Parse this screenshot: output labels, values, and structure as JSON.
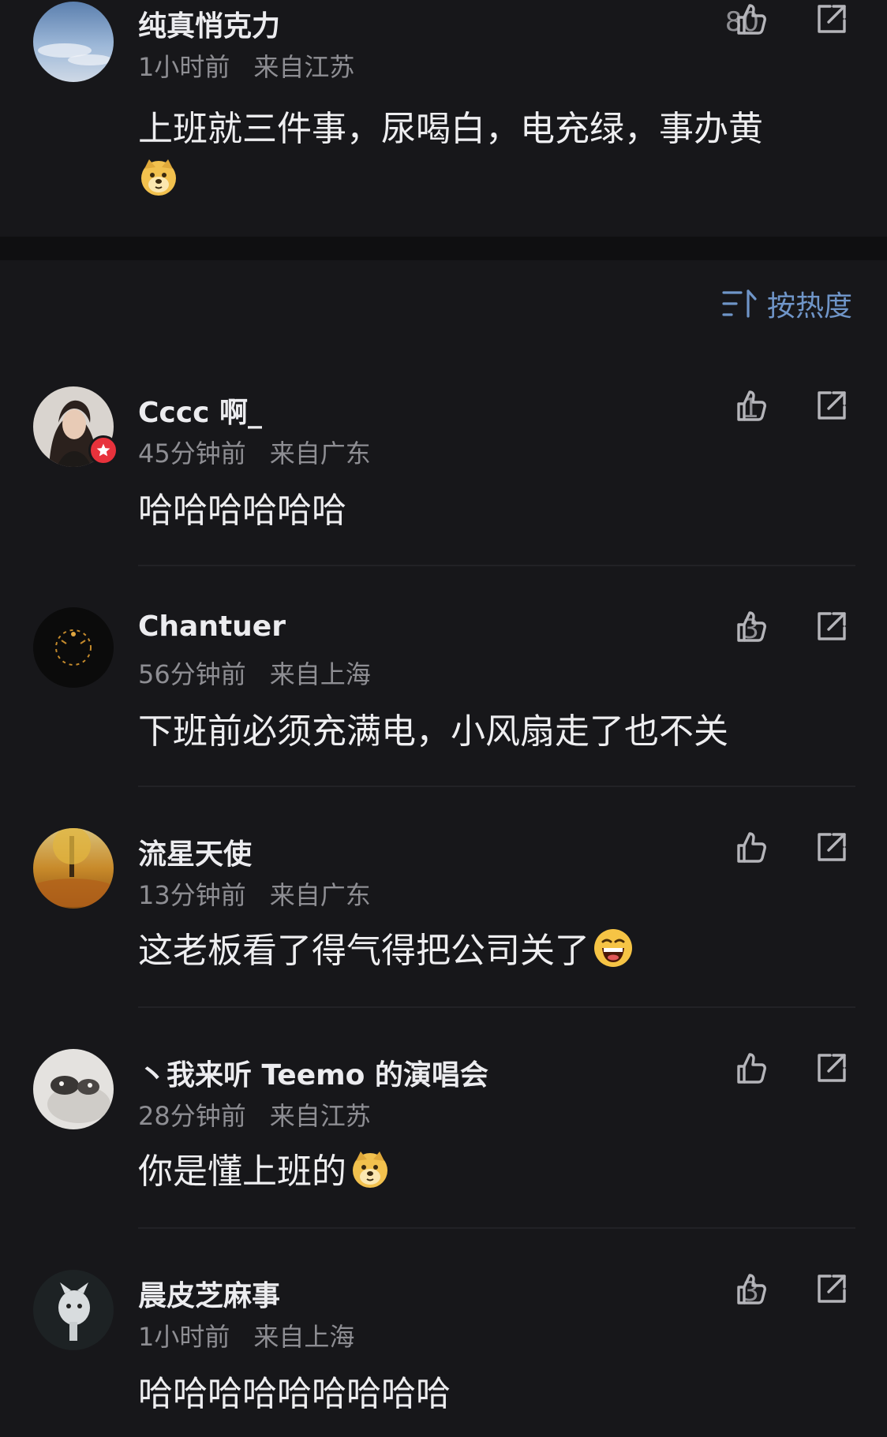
{
  "sort": {
    "label": "按热度",
    "icon": "sort-icon"
  },
  "comments": [
    {
      "username": "纯真悄克力",
      "time": "1小时前",
      "location": "来自江苏",
      "likes": "80",
      "text": "上班就三件事，尿喝白，电充绿，事办黄",
      "emoji": "doge"
    },
    {
      "username": "Cccc 啊_",
      "time": "45分钟前",
      "location": "来自广东",
      "likes": "1",
      "text": "哈哈哈哈哈哈",
      "badge": "star-badge"
    },
    {
      "username": "Chantuer",
      "time": "56分钟前",
      "location": "来自上海",
      "likes": "3",
      "text": "下班前必须充满电，小风扇走了也不关"
    },
    {
      "username": "流星天使",
      "time": "13分钟前",
      "location": "来自广东",
      "likes": "",
      "text": "这老板看了得气得把公司关了",
      "emoji": "laughing"
    },
    {
      "username": "丶我来听 Teemo 的演唱会",
      "time": "28分钟前",
      "location": "来自江苏",
      "likes": "",
      "text": "你是懂上班的",
      "emoji": "doge"
    },
    {
      "username": "晨皮芝麻事",
      "time": "1小时前",
      "location": "来自上海",
      "likes": "3",
      "text": "哈哈哈哈哈哈哈哈哈"
    }
  ],
  "colors": {
    "background": "#17171a",
    "text": "#eeeef0",
    "muted": "#8e8e93",
    "accent": "#6f95c8",
    "badge": "#e8323c"
  }
}
